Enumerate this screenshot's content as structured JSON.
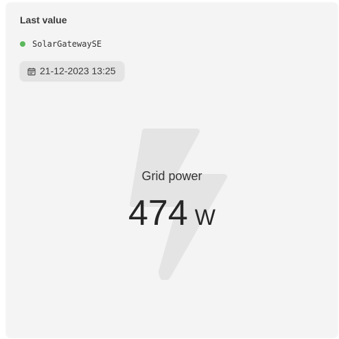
{
  "widget": {
    "title": "Last value"
  },
  "device": {
    "name": "SolarGatewaySE",
    "status_color": "#5cb85c"
  },
  "timestamp": {
    "icon": "calendar-icon",
    "label": "21-12-2023 13:25"
  },
  "metric": {
    "icon": "lightning-bolt-icon",
    "label": "Grid power",
    "value": "474",
    "unit": "W"
  }
}
